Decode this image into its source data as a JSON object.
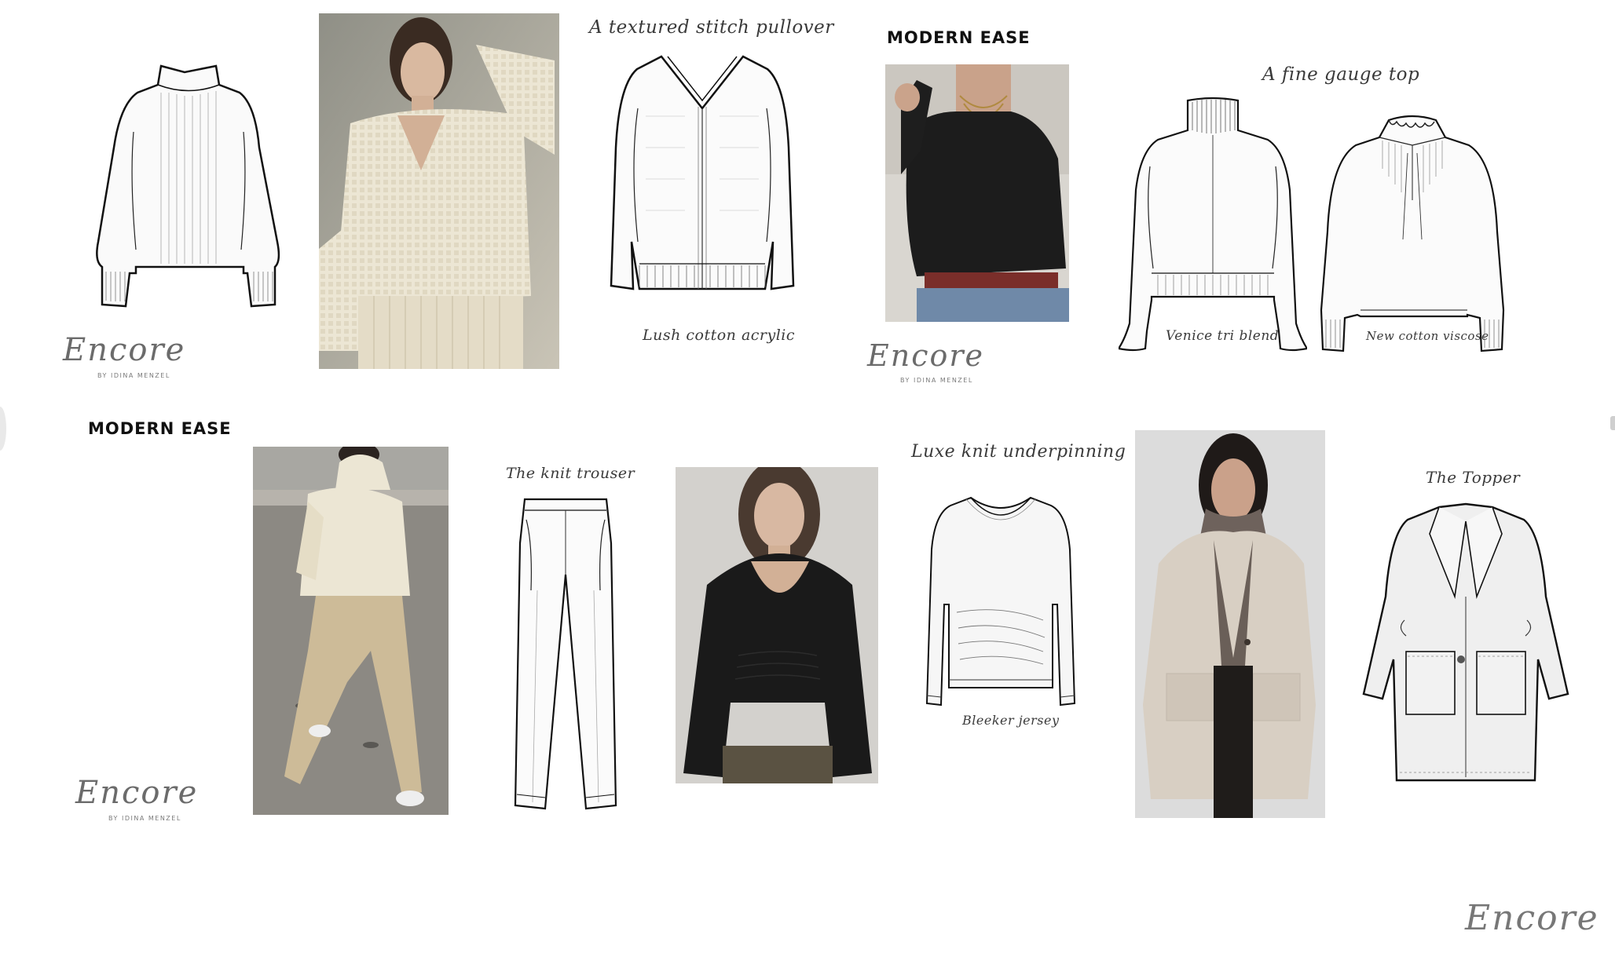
{
  "headings": {
    "top": "MODERN EASE",
    "bottom": "MODERN EASE"
  },
  "captions": {
    "textured_title": "A textured stitch pullover",
    "lush": "Lush cotton acrylic",
    "fine_gauge_title": "A fine gauge top",
    "venice": "Venice tri blend",
    "new_cotton": "New cotton viscose",
    "knit_trouser": "The knit trouser",
    "luxe_title": "Luxe knit underpinning",
    "bleeker": "Bleeker jersey",
    "topper": "The Topper"
  },
  "logos": {
    "brand": "Encore",
    "tagline": "BY IDINA MENZEL",
    "footer": "Encore"
  },
  "colors": {
    "cream_knit": "#ece6d4",
    "black_knit": "#1c1c1c",
    "oatmeal_coat": "#d8cfc3",
    "camel_trouser": "#cdbb98",
    "sketch_fill": "#f3f3f3"
  }
}
